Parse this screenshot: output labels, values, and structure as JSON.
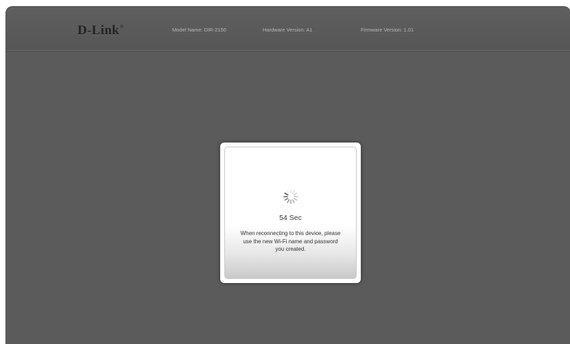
{
  "header": {
    "logo": "D-Link",
    "model": "Model Name: DIR-2150",
    "hardware": "Hardware Version: A1",
    "firmware": "Firmware Version: 1.01"
  },
  "dialog": {
    "spinner_icon": "loading-spinner-icon",
    "countdown": "54 Sec",
    "message_lines": [
      "When reconnecting to this device, please",
      "use the new Wi-Fi name and password",
      "you created."
    ]
  }
}
